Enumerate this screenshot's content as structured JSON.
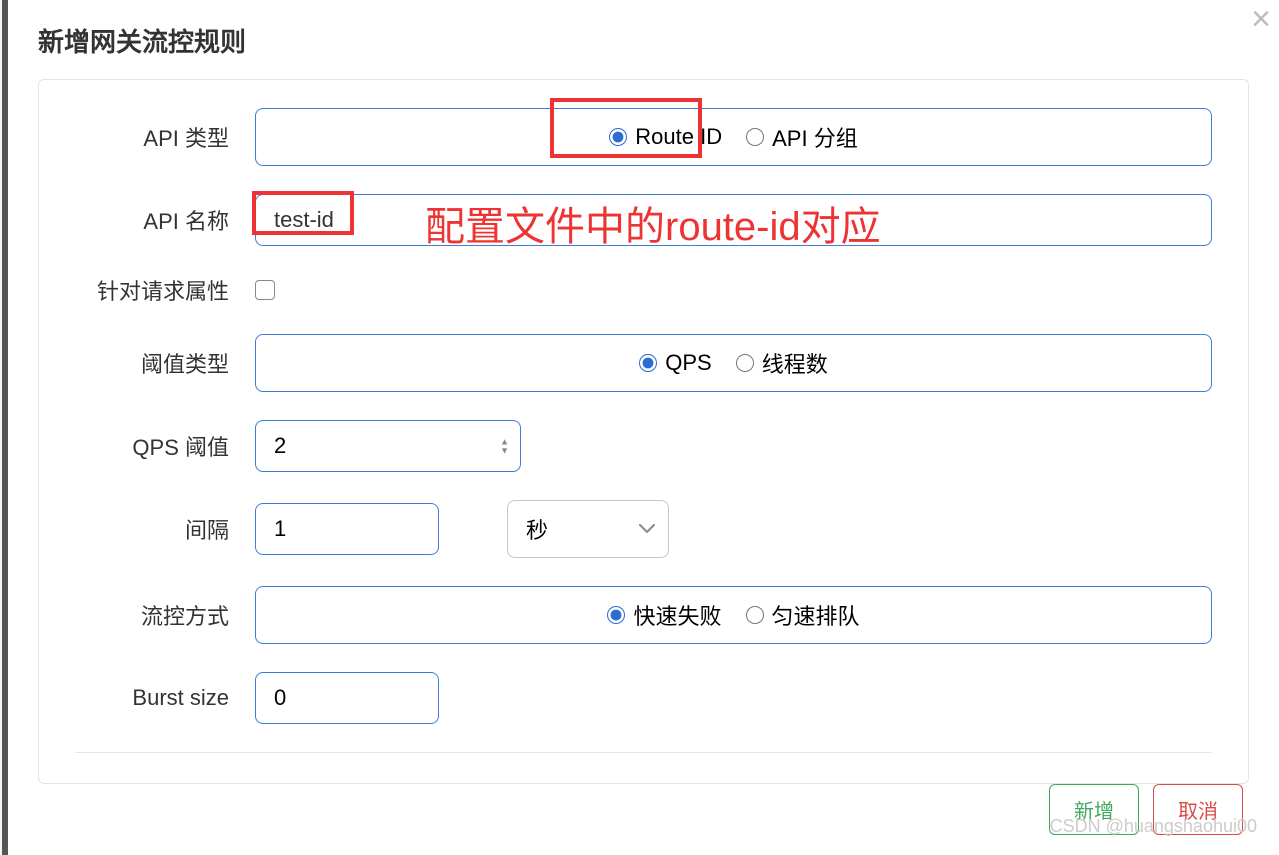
{
  "modal": {
    "title": "新增网关流控规则",
    "close": "×"
  },
  "labels": {
    "apiType": "API 类型",
    "apiName": "API 名称",
    "reqAttr": "针对请求属性",
    "thresholdType": "阈值类型",
    "qpsThreshold": "QPS 阈值",
    "interval": "间隔",
    "flowMode": "流控方式",
    "burst": "Burst size"
  },
  "apiType": {
    "routeId": "Route ID",
    "apiGroup": "API 分组"
  },
  "apiName": {
    "value": "test-id"
  },
  "thresholdType": {
    "qps": "QPS",
    "threads": "线程数"
  },
  "qpsThreshold": {
    "value": "2"
  },
  "interval": {
    "value": "1",
    "unit": "秒"
  },
  "flowMode": {
    "fast": "快速失败",
    "queue": "匀速排队"
  },
  "burst": {
    "value": "0"
  },
  "footer": {
    "add": "新增",
    "cancel": "取消"
  },
  "annotation": {
    "text": "配置文件中的route-id对应"
  },
  "watermark": "CSDN @huangshaohui00"
}
